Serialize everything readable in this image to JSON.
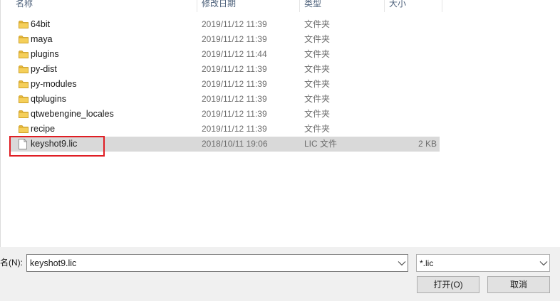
{
  "columns": {
    "name": "名称",
    "modified": "修改日期",
    "type": "类型",
    "size": "大小"
  },
  "files": [
    {
      "name": "64bit",
      "modified": "2019/11/12 11:39",
      "type": "文件夹",
      "size": "",
      "icon": "folder-icon"
    },
    {
      "name": "maya",
      "modified": "2019/11/12 11:39",
      "type": "文件夹",
      "size": "",
      "icon": "folder-icon"
    },
    {
      "name": "plugins",
      "modified": "2019/11/12 11:44",
      "type": "文件夹",
      "size": "",
      "icon": "folder-icon"
    },
    {
      "name": "py-dist",
      "modified": "2019/11/12 11:39",
      "type": "文件夹",
      "size": "",
      "icon": "folder-icon"
    },
    {
      "name": "py-modules",
      "modified": "2019/11/12 11:39",
      "type": "文件夹",
      "size": "",
      "icon": "folder-icon"
    },
    {
      "name": "qtplugins",
      "modified": "2019/11/12 11:39",
      "type": "文件夹",
      "size": "",
      "icon": "folder-icon"
    },
    {
      "name": "qtwebengine_locales",
      "modified": "2019/11/12 11:39",
      "type": "文件夹",
      "size": "",
      "icon": "folder-icon"
    },
    {
      "name": "recipe",
      "modified": "2019/11/12 11:39",
      "type": "文件夹",
      "size": "",
      "icon": "folder-icon"
    },
    {
      "name": "keyshot9.lic",
      "modified": "2018/10/11 19:06",
      "type": "LIC 文件",
      "size": "2 KB",
      "icon": "file-icon",
      "selected": true
    }
  ],
  "footer": {
    "filename_label": "名(N):",
    "filename_value": "keyshot9.lic",
    "filter_value": "*.lic",
    "open_label": "打开(O)",
    "cancel_label": "取消"
  },
  "colors": {
    "highlight": "#e01e24",
    "selected_row": "#d9d9d9",
    "folder": "#e8b93a"
  }
}
